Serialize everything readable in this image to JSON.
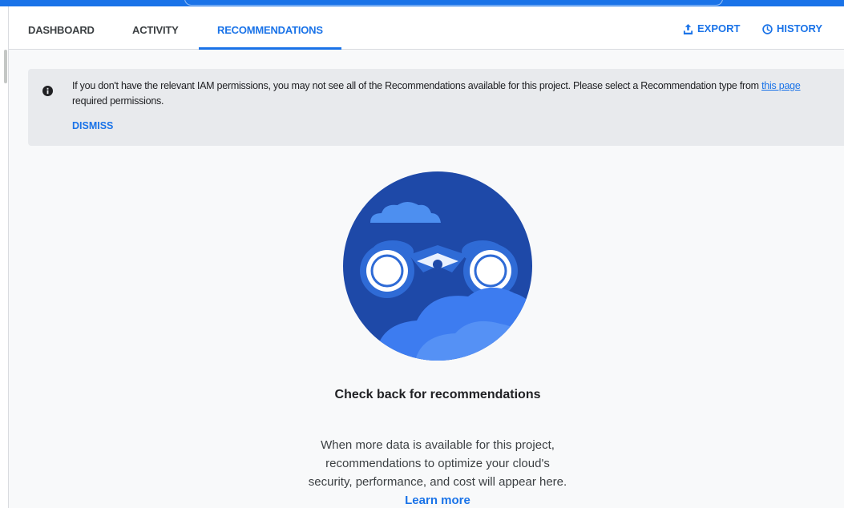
{
  "tabs": {
    "dashboard": "DASHBOARD",
    "activity": "ACTIVITY",
    "recommendations": "RECOMMENDATIONS",
    "active": "recommendations"
  },
  "actions": {
    "export": "EXPORT",
    "history": "HISTORY"
  },
  "banner": {
    "message": "If you don't have the relevant IAM permissions, you may not see all of the Recommendations available for this project. Please select a Recommendation type from ",
    "link_text": "this page",
    "message_line2": "required permissions.",
    "dismiss": "DISMISS"
  },
  "empty_state": {
    "title": "Check back for recommendations",
    "line1": "When more data is available for this project,",
    "line2": "recommendations to optimize your cloud's",
    "line3": "security, performance, and cost will appear here.",
    "learn_more": "Learn more"
  },
  "colors": {
    "accent": "#1a73e8",
    "illustration_bg": "#1e49a8",
    "cloud_light": "#4d8ff0"
  }
}
